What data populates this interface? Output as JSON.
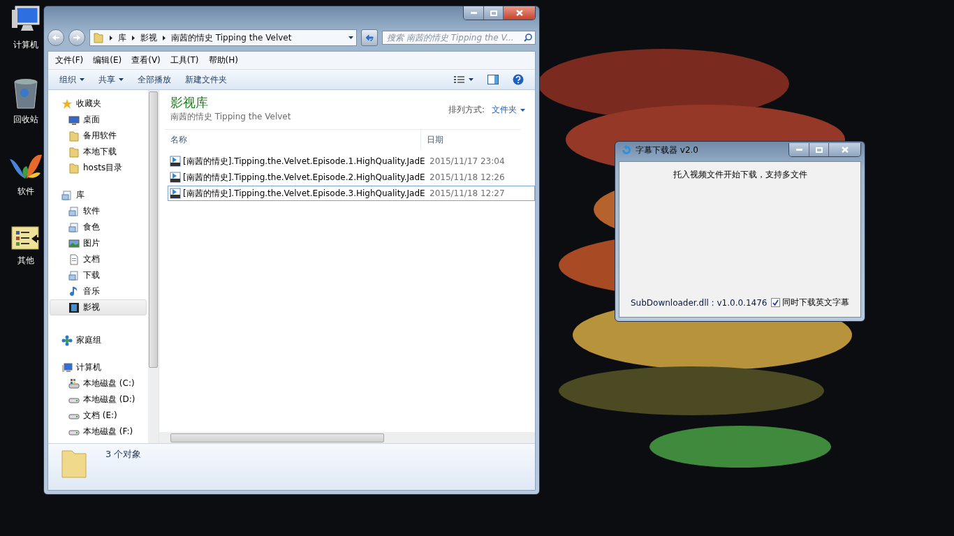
{
  "desktop_icons": [
    {
      "label": "计算机",
      "kind": "computer"
    },
    {
      "label": "回收站",
      "kind": "bin"
    },
    {
      "label": "软件",
      "kind": "butterfly"
    },
    {
      "label": "其他",
      "kind": "list"
    }
  ],
  "explorer": {
    "breadcrumb": [
      "库",
      "影视",
      "南茜的情史 Tipping the Velvet"
    ],
    "search": {
      "placeholder": "搜索 南茜的情史 Tipping the V..."
    },
    "menu": [
      "文件(F)",
      "编辑(E)",
      "查看(V)",
      "工具(T)",
      "帮助(H)"
    ],
    "toolbar": [
      {
        "label": "组织",
        "dropdown": true
      },
      {
        "label": "共享",
        "dropdown": true
      },
      {
        "label": "全部播放",
        "dropdown": false
      },
      {
        "label": "新建文件夹",
        "dropdown": false
      }
    ],
    "nav": [
      {
        "label": "收藏夹",
        "kind": "star",
        "selected": false,
        "children": [
          {
            "label": "桌面",
            "kind": "desktop",
            "selected": false
          },
          {
            "label": "备用软件",
            "kind": "folder",
            "selected": false
          },
          {
            "label": "本地下载",
            "kind": "folder",
            "selected": false
          },
          {
            "label": "hosts目录",
            "kind": "folder",
            "selected": false
          }
        ]
      },
      {
        "label": "库",
        "kind": "library",
        "selected": false,
        "children": [
          {
            "label": "软件",
            "kind": "library",
            "selected": false
          },
          {
            "label": "食色",
            "kind": "library",
            "selected": false
          },
          {
            "label": "图片",
            "kind": "picture",
            "selected": false
          },
          {
            "label": "文档",
            "kind": "document",
            "selected": false
          },
          {
            "label": "下载",
            "kind": "library",
            "selected": false
          },
          {
            "label": "音乐",
            "kind": "music",
            "selected": false
          },
          {
            "label": "影视",
            "kind": "video",
            "selected": true
          }
        ]
      },
      {
        "label": "家庭组",
        "kind": "homegroup",
        "selected": false
      },
      {
        "label": "计算机",
        "kind": "computer",
        "selected": false,
        "children": [
          {
            "label": "本地磁盘 (C:)",
            "kind": "system-drive",
            "selected": false
          },
          {
            "label": "本地磁盘 (D:)",
            "kind": "drive",
            "selected": false
          },
          {
            "label": "文档 (E:)",
            "kind": "drive",
            "selected": false
          },
          {
            "label": "本地磁盘 (F:)",
            "kind": "drive",
            "selected": false
          }
        ]
      }
    ],
    "library_title": "影视库",
    "library_subtitle": "南茜的情史 Tipping the Velvet",
    "arrange_label": "排列方式:",
    "arrange_value": "文件夹",
    "columns": [
      "名称",
      "日期"
    ],
    "files": [
      {
        "name": "[南茜的情史].Tipping.the.Velvet.Episode.1.HighQuality.JadE",
        "date": "2015/11/17 23:04",
        "selected": false
      },
      {
        "name": "[南茜的情史].Tipping.the.Velvet.Episode.2.HighQuality.JadE",
        "date": "2015/11/18 12:26",
        "selected": false
      },
      {
        "name": "[南茜的情史].Tipping.the.Velvet.Episode.3.HighQuality.JadE",
        "date": "2015/11/18 12:27",
        "selected": true
      }
    ],
    "status": "3 个对象"
  },
  "downloader": {
    "title": "字幕下载器 v2.0",
    "hint": "托入视频文件开始下载，支持多文件",
    "version": "SubDownloader.dll : v1.0.0.1476",
    "checkbox": {
      "label": "同时下载英文字幕",
      "checked": true
    }
  }
}
